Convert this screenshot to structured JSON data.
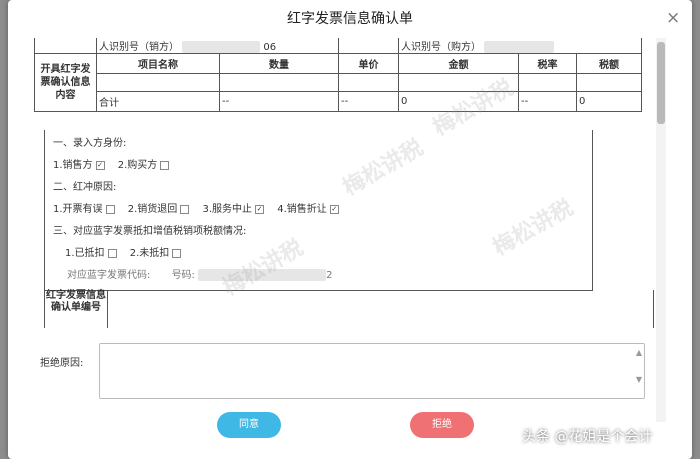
{
  "dialog": {
    "title": "红字发票信息确认单",
    "close_glyph": "×"
  },
  "top_row": {
    "seller_id_label": "人识别号（销方）",
    "seller_id_fragment": "06",
    "buyer_id_label": "人识别号（购方）"
  },
  "table": {
    "row_label": "开具红字发票确认信息内容",
    "headers": [
      "项目名称",
      "数量",
      "单价",
      "金额",
      "税率",
      "税额"
    ],
    "total_row": [
      "合计",
      "--",
      "--",
      "0",
      "--",
      "0"
    ]
  },
  "section": {
    "entry_identity_heading": "一、录入方身份:",
    "entry_options": [
      {
        "label": "1.销售方",
        "checked": true
      },
      {
        "label": "2.购买方",
        "checked": false
      }
    ],
    "reason_heading": "二、红冲原因:",
    "reason_options": [
      {
        "label": "1.开票有误",
        "checked": false
      },
      {
        "label": "2.销货退回",
        "checked": false
      },
      {
        "label": "3.服务中止",
        "checked": true
      },
      {
        "label": "4.销售折让",
        "checked": true
      }
    ],
    "deduct_heading": "三、对应蓝字发票抵扣增值税销项税额情况:",
    "deduct_options": [
      {
        "label": "1.已抵扣",
        "checked": false
      },
      {
        "label": "2.未抵扣",
        "checked": false
      }
    ],
    "blue_invoice_code_label": "对应蓝字发票代码:",
    "number_label": "号码:",
    "number_suffix": "2"
  },
  "confirmation_number_label": "红字发票信息确认单编号",
  "reject_reason_label": "拒绝原因:",
  "buttons": {
    "agree": "同意",
    "reject": "拒绝"
  },
  "watermark_text": "梅松讲税",
  "credit_text": "头条 @花姐是个会计",
  "colors": {
    "agree": "#3fb8e6",
    "reject": "#f07174"
  }
}
